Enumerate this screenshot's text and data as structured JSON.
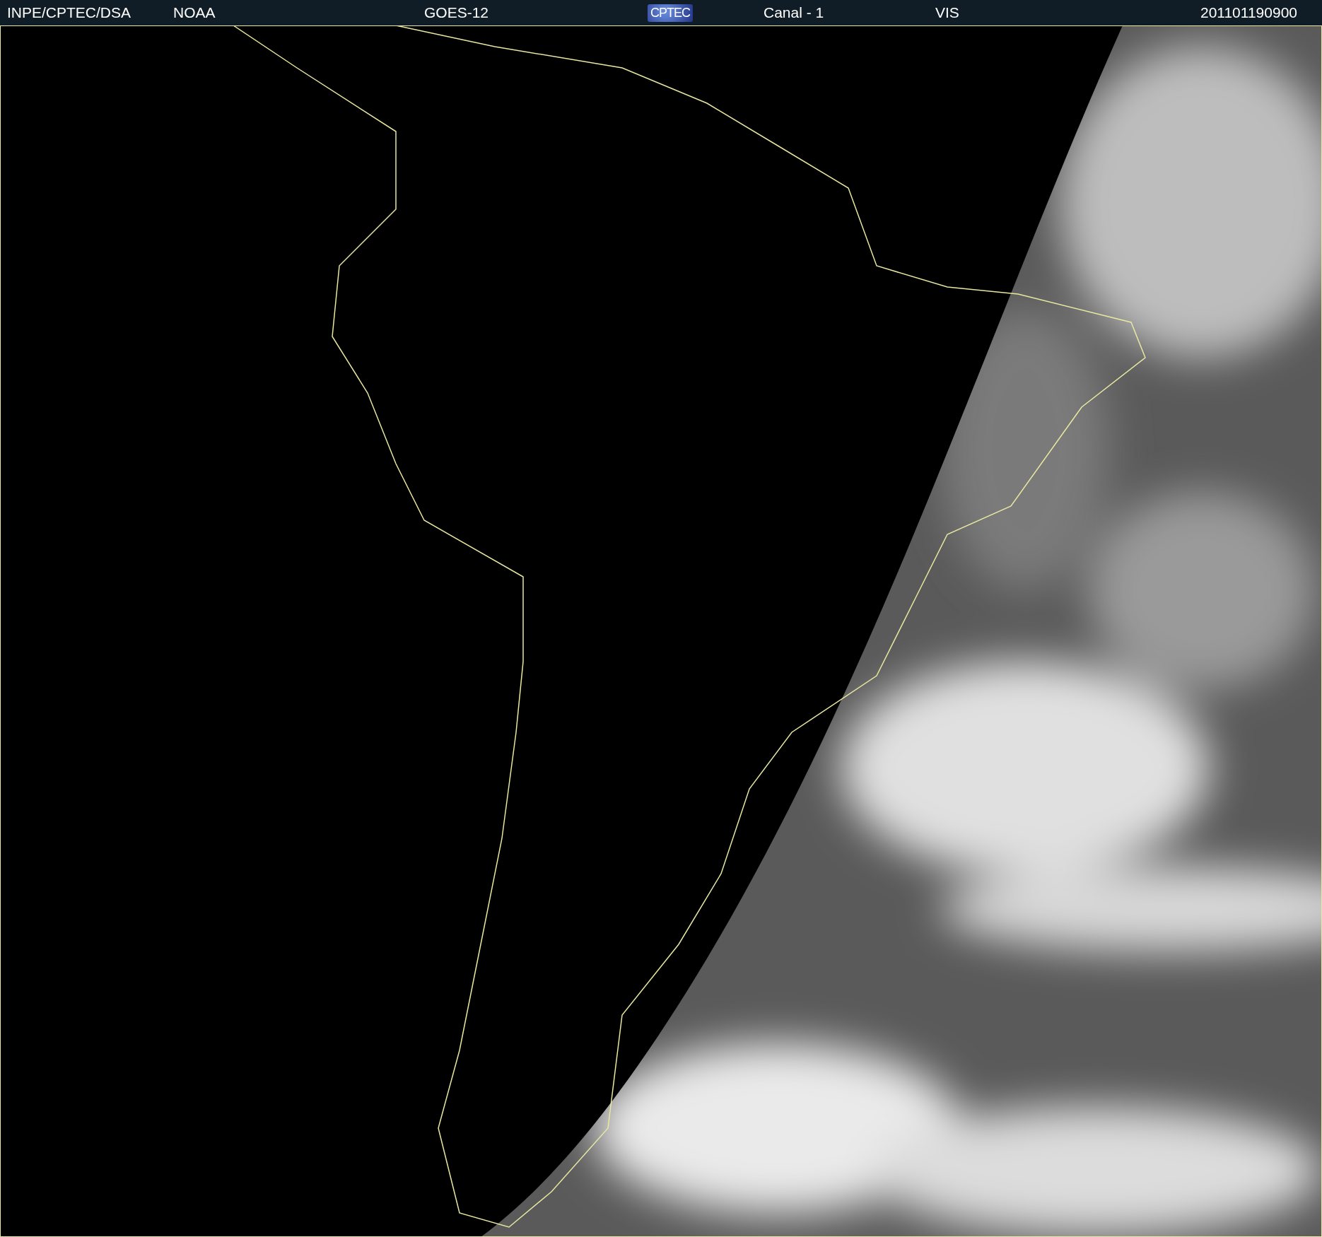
{
  "header": {
    "items": [
      {
        "kind": "text",
        "text": "INPE/CPTEC/DSA"
      },
      {
        "kind": "text",
        "text": "NOAA"
      },
      {
        "kind": "text",
        "text": "GOES-12"
      },
      {
        "kind": "logo",
        "text": "CPTEC"
      },
      {
        "kind": "text",
        "text": "Canal - 1"
      },
      {
        "kind": "text",
        "text": "VIS"
      },
      {
        "kind": "text",
        "text": "201101190900"
      }
    ]
  }
}
